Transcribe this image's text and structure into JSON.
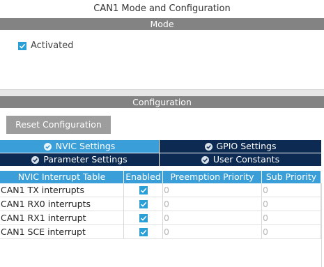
{
  "window": {
    "title": "CAN1 Mode and Configuration"
  },
  "mode": {
    "header": "Mode",
    "activated": {
      "label": "Activated",
      "checked": true
    }
  },
  "configuration": {
    "header": "Configuration",
    "reset_button": "Reset Configuration",
    "tabs": [
      {
        "label": "NVIC Settings",
        "active": true
      },
      {
        "label": "GPIO Settings",
        "active": false
      },
      {
        "label": "Parameter Settings",
        "active": false
      },
      {
        "label": "User Constants",
        "active": false
      }
    ],
    "table": {
      "headers": [
        "NVIC Interrupt Table",
        "Enabled",
        "Preemption Priority",
        "Sub Priority"
      ],
      "rows": [
        {
          "name": "CAN1 TX interrupts",
          "enabled": true,
          "preemption": "0",
          "sub": "0"
        },
        {
          "name": "CAN1 RX0 interrupts",
          "enabled": true,
          "preemption": "0",
          "sub": "0"
        },
        {
          "name": "CAN1 RX1 interrupt",
          "enabled": true,
          "preemption": "0",
          "sub": "0"
        },
        {
          "name": "CAN1 SCE interrupt",
          "enabled": true,
          "preemption": "0",
          "sub": "0"
        }
      ]
    }
  },
  "colors": {
    "accent": "#3a9fd8",
    "tab_inactive": "#0d2a52",
    "section_header": "#838383",
    "button": "#9d9d9d",
    "checkbox": "#2a9fd6"
  }
}
